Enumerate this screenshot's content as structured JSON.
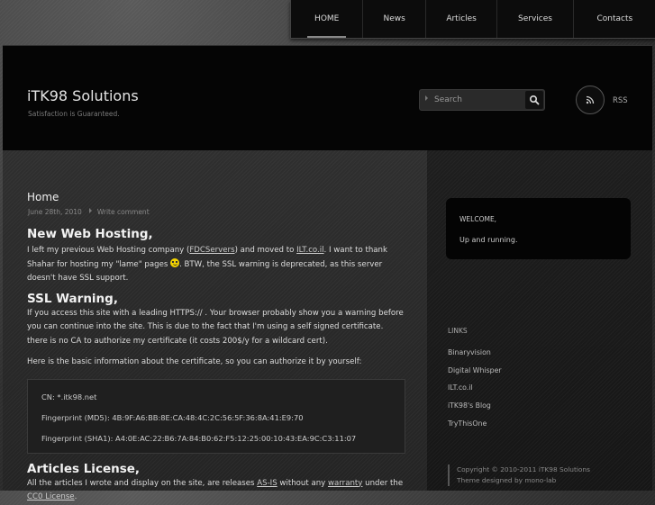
{
  "nav": {
    "items": [
      {
        "label": "HOME",
        "active": true
      },
      {
        "label": "News",
        "active": false
      },
      {
        "label": "Articles",
        "active": false
      },
      {
        "label": "Services",
        "active": false
      },
      {
        "label": "Contacts",
        "active": false
      }
    ]
  },
  "header": {
    "site_title": "iTK98 Solutions",
    "tagline": "Satisfaction is Guaranteed.",
    "search_placeholder": "Search",
    "rss_label": "RSS"
  },
  "post": {
    "title": "Home",
    "date": "June 28th, 2010",
    "comment_link": "Write comment",
    "h_hosting": "New Web Hosting,",
    "p1_a": "I left my previous Web Hosting company (",
    "p1_link1": "FDCServers",
    "p1_b": ") and moved to ",
    "p1_link2": "ILT.co.il",
    "p1_c": ". I want to thank Shahar for hosting my \"lame\" pages ",
    "p1_d": ". BTW, the SSL warning is deprecated, as this server doesn't have SSL support.",
    "h_ssl": "SSL Warning,",
    "p2": "If you access this site with a leading HTTPS:// . Your browser probably show you a warning before you can continue into the site. This is due to the fact that I'm using a self signed certificate. there is no CA to authorize my certificate (it costs 200$/y for a wildcard cert).",
    "p3": "Here is the basic information about the certificate, so you can authorize it by yourself:",
    "cert_cn": "CN: *.itk98.net",
    "cert_md5": "Fingerprint (MD5): 4B:9F:A6:BB:8E:CA:48:4C:2C:56:5F:36:8A:41:E9:70",
    "cert_sha1": "Fingerprint (SHA1): A4:0E:AC:22:B6:7A:84:B0:62:F5:12:25:00:10:43:EA:9C:C3:11:07",
    "h_license": "Articles License,",
    "p4_a": "All the articles I wrote and display on the site, are releases ",
    "p4_link1": "AS-IS",
    "p4_b": " without any ",
    "p4_link2": "warranty",
    "p4_c": " under the ",
    "p4_link3": "CC0 License",
    "p4_d": "."
  },
  "sidebar": {
    "welcome_title": "WELCOME,",
    "welcome_body": "Up and running.",
    "links_title": "LINKS",
    "links": [
      "Binaryvision",
      "Digital Whisper",
      "ILT.co.il",
      "iTK98's Blog",
      "TryThisOne"
    ],
    "copyright": "Copyright ©  2010-2011  iTK98 Solutions",
    "designed_by": "Theme designed by mono-lab"
  },
  "colors": {
    "smiley": "#f2d300",
    "nav_bg": "#0c0c0c",
    "header_bg": "#050505"
  }
}
